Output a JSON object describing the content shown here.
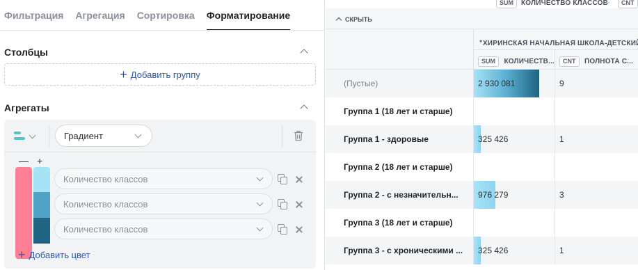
{
  "tabs": [
    "Фильтрация",
    "Агрегация",
    "Сортировка",
    "Форматирование"
  ],
  "active_tab": "Форматирование",
  "columns_section": {
    "title": "Столбцы",
    "add_group_label": "Добавить группу"
  },
  "aggregates_section": {
    "title": "Агрегаты",
    "format_type": "Градиент",
    "minus_label": "—",
    "plus_label": "+",
    "fields": [
      {
        "value": "Количество классов"
      },
      {
        "value": "Количество классов"
      },
      {
        "value": "Количество классов"
      }
    ],
    "add_color_label": "Добавить цвет",
    "negative_colors": [
      "#ff8096"
    ],
    "positive_colors": [
      "#a6e3f7",
      "#4fa3c7",
      "#1f6482"
    ]
  },
  "table": {
    "top_tags": [
      {
        "tag": "SUM",
        "label": "КОЛИЧЕСТВО КЛАССОВ"
      },
      {
        "tag": "CNT",
        "label": ""
      }
    ],
    "top_sep": "··",
    "hide_label": "СКРЫТЬ",
    "group_header": "\"ХИРИНСКАЯ НАЧАЛЬНАЯ ШКОЛА-ДЕТСКИЙ...",
    "columns": [
      {
        "tag": "SUM",
        "label": "КОЛИЧЕСТВ..."
      },
      {
        "tag": "CNT",
        "label": "ПОЛНОТА С..."
      }
    ],
    "rows": [
      {
        "label": "(Пустые)",
        "style": "empty",
        "sum": "2 930 081",
        "cnt": "9",
        "fill": 1.0
      },
      {
        "label": "Группа 1 (18 лет и старше)",
        "style": "bold",
        "sum": "",
        "cnt": "",
        "fill": 0
      },
      {
        "label": "Группа 1 - здоровые",
        "style": "bold",
        "sum": "325 426",
        "cnt": "1",
        "fill": 0.11
      },
      {
        "label": "Группа 2 (18 лет и старше)",
        "style": "bold",
        "sum": "",
        "cnt": "",
        "fill": 0
      },
      {
        "label": "Группа 2 - с незначительн...",
        "style": "bold",
        "sum": "976 279",
        "cnt": "3",
        "fill": 0.33
      },
      {
        "label": "Группа 3 (18 лет и старше)",
        "style": "bold",
        "sum": "",
        "cnt": "",
        "fill": 0
      },
      {
        "label": "Группа 3 - с хроническими ...",
        "style": "bold",
        "sum": "325 426",
        "cnt": "1",
        "fill": 0.11
      }
    ]
  }
}
